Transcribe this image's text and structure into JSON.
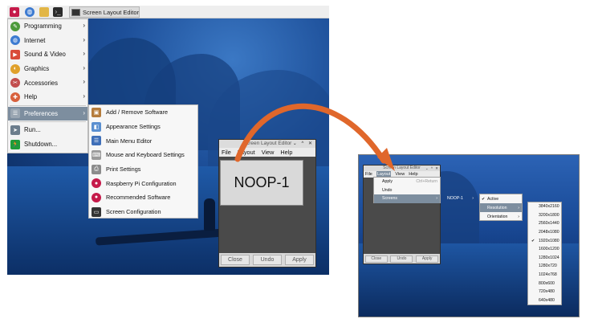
{
  "left": {
    "taskbar": {
      "task_label": "Screen Layout Editor"
    },
    "start_menu": {
      "items": [
        {
          "label": "Programming",
          "icon": "programming-icon",
          "color": "#4c9a3b"
        },
        {
          "label": "Internet",
          "icon": "globe-icon",
          "color": "#3d7bd1"
        },
        {
          "label": "Sound & Video",
          "icon": "media-icon",
          "color": "#d94c3a"
        },
        {
          "label": "Graphics",
          "icon": "graphics-icon",
          "color": "#e0a12b"
        },
        {
          "label": "Accessories",
          "icon": "accessories-icon",
          "color": "#c24d4d"
        },
        {
          "label": "Help",
          "icon": "help-icon",
          "color": "#d8603c"
        },
        {
          "label": "Preferences",
          "icon": "preferences-icon",
          "color": "#7a8a99"
        },
        {
          "label": "Run...",
          "icon": "run-icon",
          "color": "#6c7d8c"
        },
        {
          "label": "Shutdown...",
          "icon": "shutdown-icon",
          "color": "#1e9c3a"
        }
      ]
    },
    "preferences_submenu": [
      {
        "label": "Add / Remove Software",
        "icon": "package-icon",
        "color": "#b57c3c"
      },
      {
        "label": "Appearance Settings",
        "icon": "appearance-icon",
        "color": "#5a8fd0"
      },
      {
        "label": "Main Menu Editor",
        "icon": "menu-editor-icon",
        "color": "#3f6fb8"
      },
      {
        "label": "Mouse and Keyboard Settings",
        "icon": "keyboard-icon",
        "color": "#9a9a9a"
      },
      {
        "label": "Print Settings",
        "icon": "printer-icon",
        "color": "#8c8c8c"
      },
      {
        "label": "Raspberry Pi Configuration",
        "icon": "raspberry-icon",
        "color": "#c51a4a"
      },
      {
        "label": "Recommended Software",
        "icon": "raspberry-icon",
        "color": "#c51a4a"
      },
      {
        "label": "Screen Configuration",
        "icon": "monitor-icon",
        "color": "#333333"
      }
    ],
    "editor_window": {
      "title": "Screen Layout Editor",
      "menu": [
        "File",
        "Layout",
        "View",
        "Help"
      ],
      "screen_label": "NOOP-1",
      "buttons": [
        "Close",
        "Undo",
        "Apply"
      ]
    }
  },
  "right": {
    "editor_window": {
      "title": "Screen Layout Editor",
      "menu": [
        "File",
        "Layout",
        "View",
        "Help"
      ],
      "buttons": [
        "Close",
        "Undo",
        "Apply"
      ]
    },
    "layout_menu": {
      "apply": "Apply",
      "apply_shortcut": "Ctrl+Return",
      "undo": "Undo",
      "screens": "Screens"
    },
    "screen_submenu": "NOOP-1",
    "screen_options": [
      "Active",
      "Resolution",
      "Orientation"
    ],
    "resolutions": [
      "3840x2160",
      "3200x1800",
      "2560x1440",
      "2048x1080",
      "1920x1080",
      "1600x1200",
      "1280x1024",
      "1280x720",
      "1024x768",
      "800x600",
      "720x480",
      "640x480"
    ],
    "selected_resolution": "1920x1080",
    "arrow_color": "#e0672b"
  }
}
